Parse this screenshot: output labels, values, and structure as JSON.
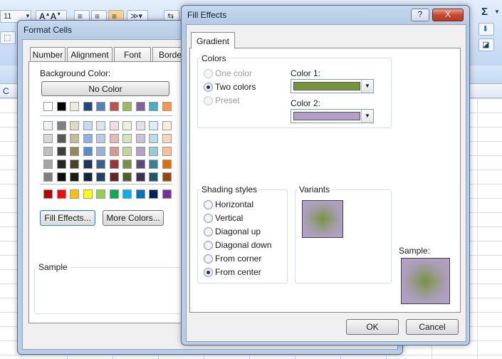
{
  "ribbon": {
    "font_size": "11",
    "sigma_icon": "sigma-icon",
    "col_c": "C"
  },
  "format_cells": {
    "title": "Format Cells",
    "tabs": [
      "Number",
      "Alignment",
      "Font",
      "Border"
    ],
    "background_color_label": "Background Color:",
    "no_color_button": "No Color",
    "fill_effects_button": "Fill Effects...",
    "more_colors_button": "More Colors...",
    "sample_label": "Sample",
    "top_colors": [
      "#ffffff",
      "#000000",
      "#eeece1",
      "#1f497d",
      "#4f81bd",
      "#c0504d",
      "#9bbb59",
      "#8064a2",
      "#4bacc6",
      "#f79646"
    ],
    "shade_rows": [
      [
        "#f2f2f2",
        "#7f7f7f",
        "#ddd9c3",
        "#c6d9f0",
        "#dbe5f1",
        "#f2dcdb",
        "#ebf1dd",
        "#e5e0ec",
        "#dbeef3",
        "#fdeada"
      ],
      [
        "#d8d8d8",
        "#595959",
        "#c4bd97",
        "#8db3e2",
        "#b8cce4",
        "#e5b9b7",
        "#d7e3bc",
        "#ccc1d9",
        "#b7dde8",
        "#fbd5b5"
      ],
      [
        "#bfbfbf",
        "#3f3f3f",
        "#938953",
        "#548dd4",
        "#95b3d7",
        "#d99694",
        "#c3d69b",
        "#b2a2c7",
        "#92cddc",
        "#fac08f"
      ],
      [
        "#a5a5a5",
        "#262626",
        "#494429",
        "#17365d",
        "#366092",
        "#953734",
        "#76923c",
        "#5f497a",
        "#31859b",
        "#e36c09"
      ],
      [
        "#7f7f7f",
        "#0c0c0c",
        "#1d1b10",
        "#0f243e",
        "#244061",
        "#632423",
        "#4f6128",
        "#3f3151",
        "#205867",
        "#974806"
      ]
    ],
    "standard_colors": [
      "#c00000",
      "#ff0000",
      "#ffc000",
      "#ffff00",
      "#92d050",
      "#00b050",
      "#00b0f0",
      "#0070c0",
      "#002060",
      "#7030a0"
    ]
  },
  "fill_effects": {
    "title": "Fill Effects",
    "help_button": "?",
    "close_button": "X",
    "tab": "Gradient",
    "colors_group": "Colors",
    "one_color": "One color",
    "two_colors": "Two colors",
    "preset": "Preset",
    "color1_label": "Color 1:",
    "color2_label": "Color 2:",
    "color1": "#77933c",
    "color2": "#b1a0c7",
    "shading_group": "Shading styles",
    "shading_styles": [
      "Horizontal",
      "Vertical",
      "Diagonal up",
      "Diagonal down",
      "From corner",
      "From center"
    ],
    "selected_style": 5,
    "variants_group": "Variants",
    "sample_label": "Sample:",
    "ok_button": "OK",
    "cancel_button": "Cancel"
  }
}
